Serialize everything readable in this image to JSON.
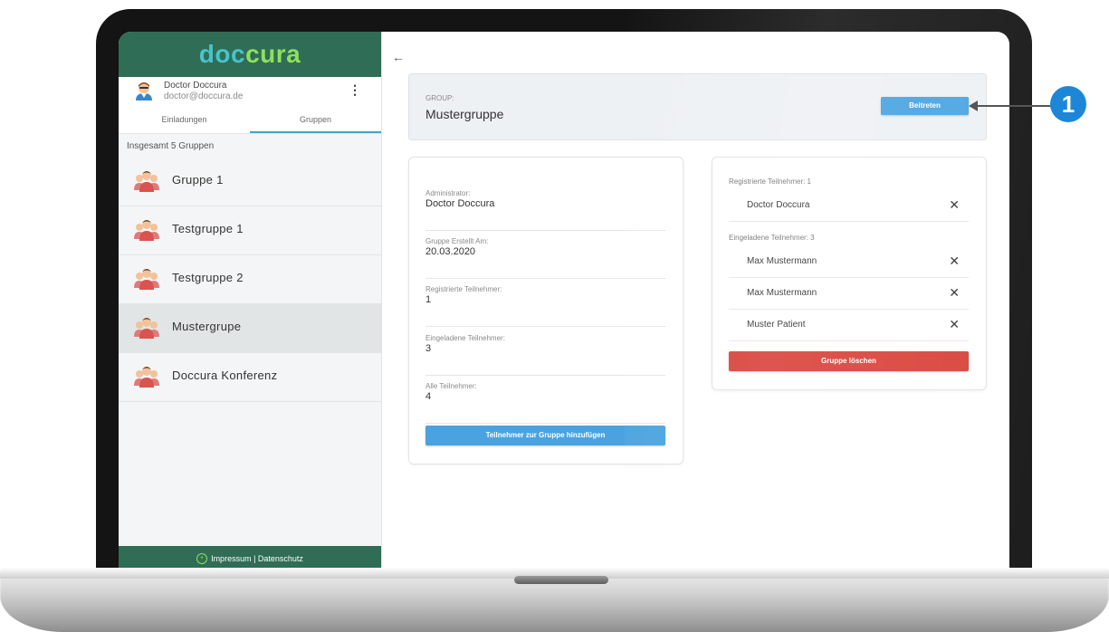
{
  "brand": {
    "part1": "doc",
    "part2": "cura"
  },
  "user": {
    "name": "Doctor Doccura",
    "email": "doctor@doccura.de",
    "menu_glyph": "⋮"
  },
  "tabs": [
    {
      "label": "Einladungen",
      "active": false
    },
    {
      "label": "Gruppen",
      "active": true
    }
  ],
  "group_count": "Insgesamt 5 Gruppen",
  "groups": [
    {
      "name": "Gruppe 1",
      "selected": false
    },
    {
      "name": "Testgruppe 1",
      "selected": false
    },
    {
      "name": "Testgruppe 2",
      "selected": false
    },
    {
      "name": "Mustergrupe",
      "selected": true
    },
    {
      "name": "Doccura Konferenz",
      "selected": false
    }
  ],
  "footer": {
    "icon": "plus-circle-icon",
    "text": "Impressum | Datenschutz"
  },
  "back_glyph": "←",
  "header": {
    "label": "GROUP:",
    "title": "Mustergruppe",
    "join_label": "Beitreten"
  },
  "info": [
    {
      "label": "Administrator:",
      "value": "Doctor Doccura"
    },
    {
      "label": "Gruppe Erstellt Am:",
      "value": "20.03.2020"
    },
    {
      "label": "Registrierte Teilnehmer:",
      "value": "1"
    },
    {
      "label": "Eingeladene Teilnehmer:",
      "value": "3"
    },
    {
      "label": "Alle Teilnehmer:",
      "value": "4"
    }
  ],
  "add_button_label": "Teilnehmer zur Gruppe hinzufügen",
  "members": {
    "registered_heading": "Registrierte Teilnehmer: 1",
    "registered": [
      {
        "name": "Doctor Doccura"
      }
    ],
    "invited_heading": "Eingeladene Teilnehmer: 3",
    "invited": [
      {
        "name": "Max Mustermann"
      },
      {
        "name": "Max Mustermann"
      },
      {
        "name": "Muster Patient"
      }
    ],
    "remove_glyph": "✕"
  },
  "delete_button_label": "Gruppe löschen",
  "callout_number": "1",
  "colors": {
    "brand_green": "#2f6d57",
    "accent_blue": "#4aa3e0",
    "danger_red": "#d9423a",
    "callout_blue": "#1e86d6"
  }
}
